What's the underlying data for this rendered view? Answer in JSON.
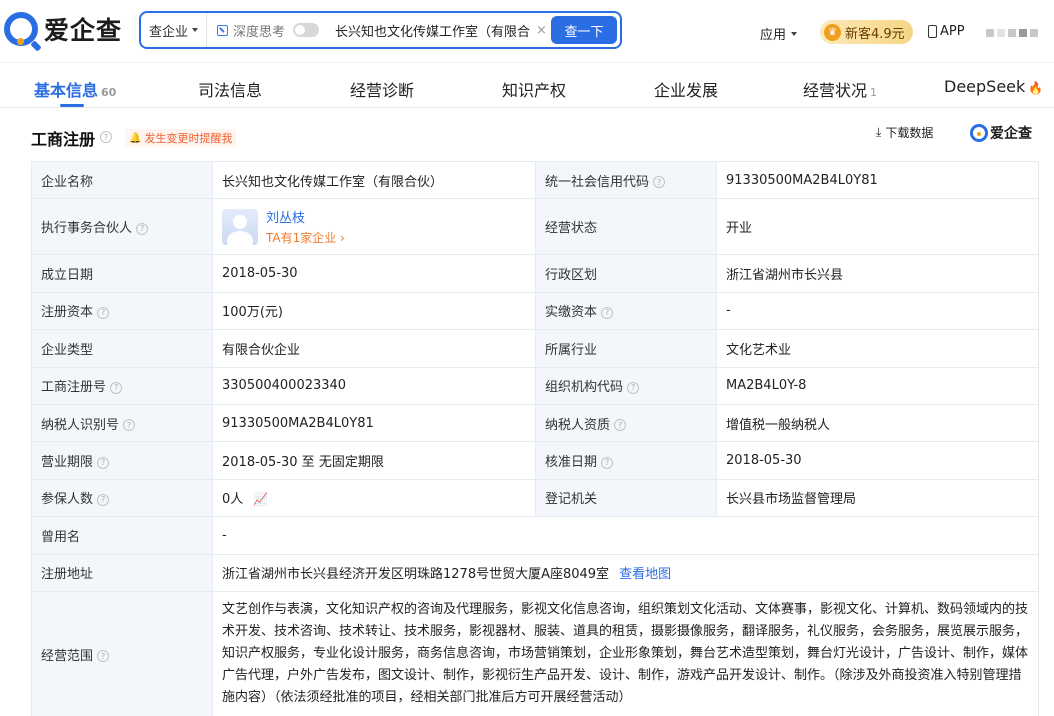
{
  "header": {
    "logo_text": "爱企查",
    "search_type": "查企业",
    "deep_think": "深度思考",
    "search_value": "长兴知也文化传媒工作室（有限合伙）",
    "search_button": "查一下",
    "app_menu": "应用",
    "new_user_badge": "新客4.9元",
    "app_link": "APP"
  },
  "tabs": [
    {
      "label": "基本信息",
      "count": "60",
      "active": true
    },
    {
      "label": "司法信息",
      "count": ""
    },
    {
      "label": "经营诊断",
      "count": ""
    },
    {
      "label": "知识产权",
      "count": ""
    },
    {
      "label": "企业发展",
      "count": ""
    },
    {
      "label": "经营状况",
      "count": "1"
    },
    {
      "label": "DeepSeek",
      "count": ""
    }
  ],
  "section": {
    "title": "工商注册",
    "notify": "发生变更时提醒我",
    "download": "下载数据",
    "logo_text": "爱企查"
  },
  "registration": {
    "company_name_label": "企业名称",
    "company_name": "长兴知也文化传媒工作室（有限合伙）",
    "credit_code_label": "统一社会信用代码",
    "credit_code": "91330500MA2B4L0Y81",
    "partner_label": "执行事务合伙人",
    "partner_name": "刘丛枝",
    "partner_link": "TA有1家企业 ›",
    "status_label": "经营状态",
    "status": "开业",
    "founded_label": "成立日期",
    "founded": "2018-05-30",
    "region_label": "行政区划",
    "region": "浙江省湖州市长兴县",
    "capital_label": "注册资本",
    "capital": "100万(元)",
    "paid_capital_label": "实缴资本",
    "paid_capital": "-",
    "type_label": "企业类型",
    "type": "有限合伙企业",
    "industry_label": "所属行业",
    "industry": "文化艺术业",
    "reg_no_label": "工商注册号",
    "reg_no": "330500400023340",
    "org_code_label": "组织机构代码",
    "org_code": "MA2B4L0Y-8",
    "taxpayer_id_label": "纳税人识别号",
    "taxpayer_id": "91330500MA2B4L0Y81",
    "taxpayer_qual_label": "纳税人资质",
    "taxpayer_qual": "增值税一般纳税人",
    "term_label": "营业期限",
    "term": "2018-05-30 至 无固定期限",
    "approval_label": "核准日期",
    "approval": "2018-05-30",
    "insured_label": "参保人数",
    "insured": "0人",
    "authority_label": "登记机关",
    "authority": "长兴县市场监督管理局",
    "former_name_label": "曾用名",
    "former_name": "-",
    "address_label": "注册地址",
    "address": "浙江省湖州市长兴县经济开发区明珠路1278号世贸大厦A座8049室",
    "map_link": "查看地图",
    "scope_label": "经营范围",
    "scope": "文艺创作与表演，文化知识产权的咨询及代理服务，影视文化信息咨询，组织策划文化活动、文体赛事，影视文化、计算机、数码领域内的技术开发、技术咨询、技术转让、技术服务，影视器材、服装、道具的租赁，摄影摄像服务，翻译服务，礼仪服务，会务服务，展览展示服务，知识产权服务，专业化设计服务，商务信息咨询，市场营销策划，企业形象策划，舞台艺术造型策划，舞台灯光设计，广告设计、制作，媒体广告代理，户外广告发布，图文设计、制作，影视衍生产品开发、设计、制作，游戏产品开发设计、制作。（除涉及外商投资准入特别管理措施内容）（依法须经批准的项目，经相关部门批准后方可开展经营活动）"
  },
  "colors": {
    "brand": "#2b6de3",
    "label_bg": "#f3f6fa",
    "notify": "#f0622e",
    "link_orange": "#f07a2c"
  }
}
